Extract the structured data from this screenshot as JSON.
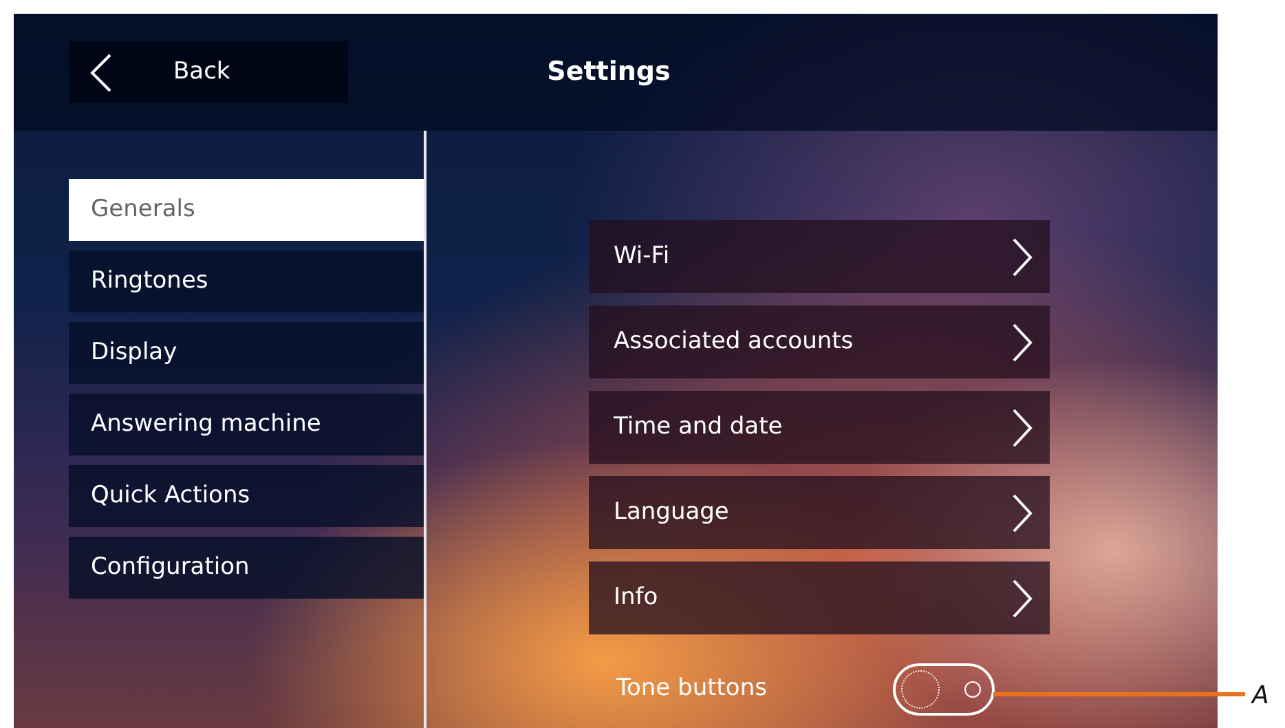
{
  "header": {
    "back": {
      "label": "Back"
    },
    "title": "Settings"
  },
  "sidebar": {
    "items": [
      {
        "label": "Generals",
        "selected": true
      },
      {
        "label": "Ringtones",
        "selected": false
      },
      {
        "label": "Display",
        "selected": false
      },
      {
        "label": "Answering machine",
        "selected": false
      },
      {
        "label": "Quick Actions",
        "selected": false
      },
      {
        "label": "Configuration",
        "selected": false
      }
    ]
  },
  "settings": [
    {
      "label": "Wi-Fi"
    },
    {
      "label": "Associated accounts"
    },
    {
      "label": "Time and date"
    },
    {
      "label": "Language"
    },
    {
      "label": "Info"
    }
  ],
  "tone_buttons": {
    "label": "Tone buttons",
    "on": false
  },
  "callout": {
    "label": "A"
  }
}
